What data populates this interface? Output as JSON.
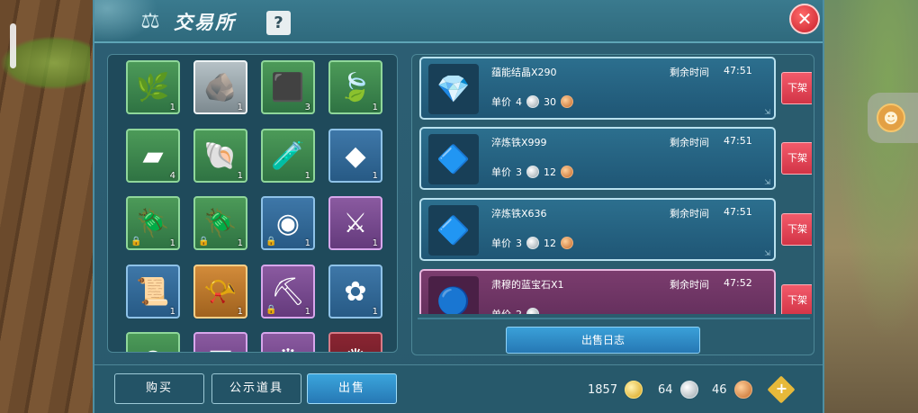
{
  "header": {
    "title": "交易所",
    "help_label": "?",
    "close_label": "✕"
  },
  "inventory": {
    "slots": [
      {
        "icon": "branch-icon",
        "glyph": "🌿",
        "rarity": "green",
        "count": "1",
        "locked": false
      },
      {
        "icon": "copper-ore-icon",
        "glyph": "🪨",
        "rarity": "white",
        "count": "1",
        "locked": false
      },
      {
        "icon": "coal-ore-icon",
        "glyph": "⬛",
        "rarity": "green",
        "count": "3",
        "locked": false
      },
      {
        "icon": "leaf-icon",
        "glyph": "🍃",
        "rarity": "green",
        "count": "1",
        "locked": false
      },
      {
        "icon": "iron-ingot-icon",
        "glyph": "▰",
        "rarity": "green",
        "count": "4",
        "locked": false
      },
      {
        "icon": "seashell-icon",
        "glyph": "🐚",
        "rarity": "green",
        "count": "1",
        "locked": false
      },
      {
        "icon": "potion-bottle-icon",
        "glyph": "🧪",
        "rarity": "green",
        "count": "1",
        "locked": false
      },
      {
        "icon": "crystal-shard-icon",
        "glyph": "◆",
        "rarity": "blue",
        "count": "1",
        "locked": false
      },
      {
        "icon": "blue-beetle-icon",
        "glyph": "🪲",
        "rarity": "green",
        "count": "1",
        "locked": true
      },
      {
        "icon": "blue-beetle-icon",
        "glyph": "🪲",
        "rarity": "green",
        "count": "1",
        "locked": true
      },
      {
        "icon": "stone-disc-icon",
        "glyph": "◉",
        "rarity": "blue",
        "count": "1",
        "locked": true
      },
      {
        "icon": "dark-staff-icon",
        "glyph": "⚔",
        "rarity": "purple",
        "count": "1",
        "locked": false
      },
      {
        "icon": "recipe-scroll-icon",
        "glyph": "📜",
        "rarity": "blue",
        "count": "1",
        "locked": false
      },
      {
        "icon": "horn-icon",
        "glyph": "📯",
        "rarity": "orange",
        "count": "1",
        "locked": false
      },
      {
        "icon": "scythe-icon",
        "glyph": "⛏",
        "rarity": "purple",
        "count": "1",
        "locked": true
      },
      {
        "icon": "white-flower-icon",
        "glyph": "✿",
        "rarity": "blue",
        "count": "1",
        "locked": false
      },
      {
        "icon": "green-item-icon",
        "glyph": "●",
        "rarity": "green",
        "count": "",
        "locked": false
      },
      {
        "icon": "wood-plank-icon",
        "glyph": "▤",
        "rarity": "purple",
        "count": "",
        "locked": false
      },
      {
        "icon": "crown-item-icon",
        "glyph": "♛",
        "rarity": "purple",
        "count": "",
        "locked": false
      },
      {
        "icon": "red-emblem-icon",
        "glyph": "✺",
        "rarity": "red",
        "count": "",
        "locked": false
      }
    ]
  },
  "listings": [
    {
      "icon": "purple-crystal-icon",
      "glyph": "💎",
      "style": "blue",
      "name": "蕴能结晶X290",
      "time_label": "剩余时间",
      "time": "47:51",
      "price_label": "单价",
      "silver": "4",
      "copper": "30",
      "unlist_label": "下架"
    },
    {
      "icon": "refined-iron-icon",
      "glyph": "🔷",
      "style": "blue",
      "name": "淬炼铁X999",
      "time_label": "剩余时间",
      "time": "47:51",
      "price_label": "单价",
      "silver": "3",
      "copper": "12",
      "unlist_label": "下架"
    },
    {
      "icon": "refined-iron-icon",
      "glyph": "🔷",
      "style": "blue",
      "name": "淬炼铁X636",
      "time_label": "剩余时间",
      "time": "47:51",
      "price_label": "单价",
      "silver": "3",
      "copper": "12",
      "unlist_label": "下架"
    },
    {
      "icon": "sapphire-icon",
      "glyph": "🔵",
      "style": "purple",
      "name": "肃穆的蓝宝石X1",
      "time_label": "剩余时间",
      "time": "47:52",
      "price_label": "单价",
      "silver": "2",
      "copper": "",
      "unlist_label": "下架"
    }
  ],
  "sales_log_label": "出售日志",
  "tabs": {
    "buy_label": "购买",
    "public_label": "公示道具",
    "sell_label": "出售"
  },
  "currency": {
    "gold": "1857",
    "silver": "64",
    "copper": "46",
    "add_label": "+"
  },
  "colors": {
    "panel": "#2c5f74",
    "accent": "#2678b4",
    "unlist": "#d23446"
  }
}
